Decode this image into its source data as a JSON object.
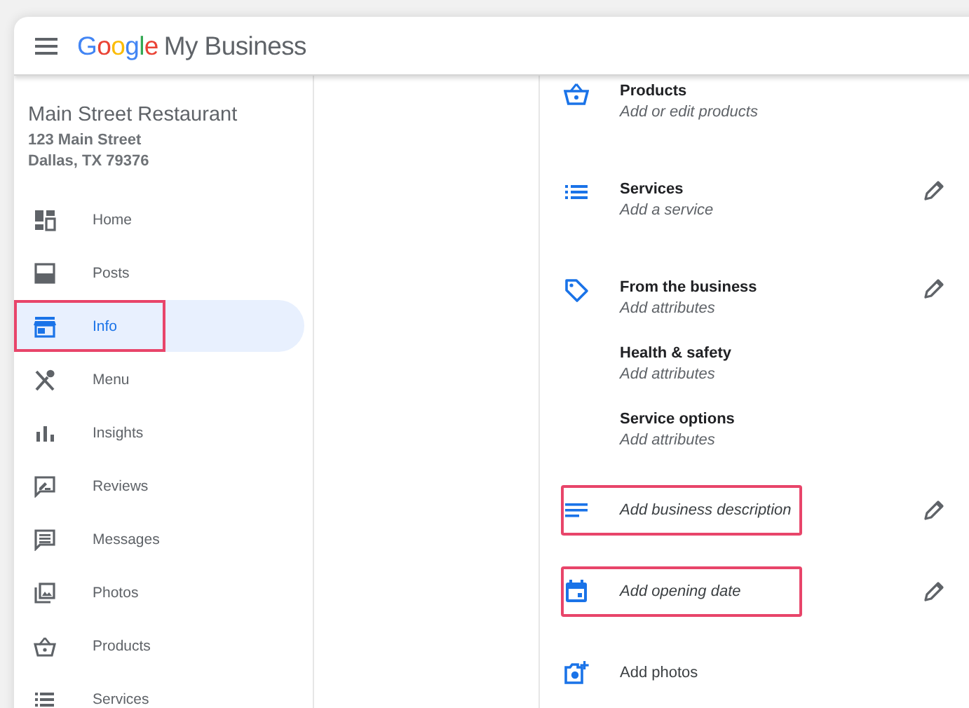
{
  "header": {
    "logo_brand": "Google",
    "logo_product": "My Business"
  },
  "business": {
    "name": "Main Street Restaurant",
    "address_lines": [
      "123 Main Street",
      "Dallas, TX 79376"
    ]
  },
  "sidebar": {
    "items": [
      {
        "label": "Home",
        "selected": false,
        "highlighted": false
      },
      {
        "label": "Posts",
        "selected": false,
        "highlighted": false
      },
      {
        "label": "Info",
        "selected": true,
        "highlighted": true
      },
      {
        "label": "Menu",
        "selected": false,
        "highlighted": false
      },
      {
        "label": "Insights",
        "selected": false,
        "highlighted": false
      },
      {
        "label": "Reviews",
        "selected": false,
        "highlighted": false
      },
      {
        "label": "Messages",
        "selected": false,
        "highlighted": false
      },
      {
        "label": "Photos",
        "selected": false,
        "highlighted": false
      },
      {
        "label": "Products",
        "selected": false,
        "highlighted": false
      },
      {
        "label": "Services",
        "selected": false,
        "highlighted": false
      }
    ]
  },
  "info_sections": [
    {
      "items": [
        {
          "kind": "entry",
          "title": "Products",
          "subtitle": "Add or edit products",
          "editable": false,
          "highlighted": false
        }
      ]
    },
    {
      "items": [
        {
          "kind": "entry",
          "title": "Services",
          "subtitle": "Add a service",
          "editable": true,
          "highlighted": false
        }
      ]
    },
    {
      "items": [
        {
          "kind": "entry",
          "title": "From the business",
          "subtitle": "Add attributes",
          "editable": true,
          "highlighted": false
        },
        {
          "kind": "entry",
          "title": "Health & safety",
          "subtitle": "Add attributes",
          "editable": false,
          "highlighted": false
        },
        {
          "kind": "entry",
          "title": "Service options",
          "subtitle": "Add attributes",
          "editable": false,
          "highlighted": false
        }
      ]
    },
    {
      "items": [
        {
          "kind": "prompt",
          "title": "Add business description",
          "editable": true,
          "highlighted": true
        }
      ]
    },
    {
      "items": [
        {
          "kind": "prompt",
          "title": "Add opening date",
          "editable": true,
          "highlighted": true
        }
      ]
    },
    {
      "items": [
        {
          "kind": "action",
          "title": "Add photos",
          "editable": false,
          "highlighted": false
        }
      ]
    }
  ]
}
